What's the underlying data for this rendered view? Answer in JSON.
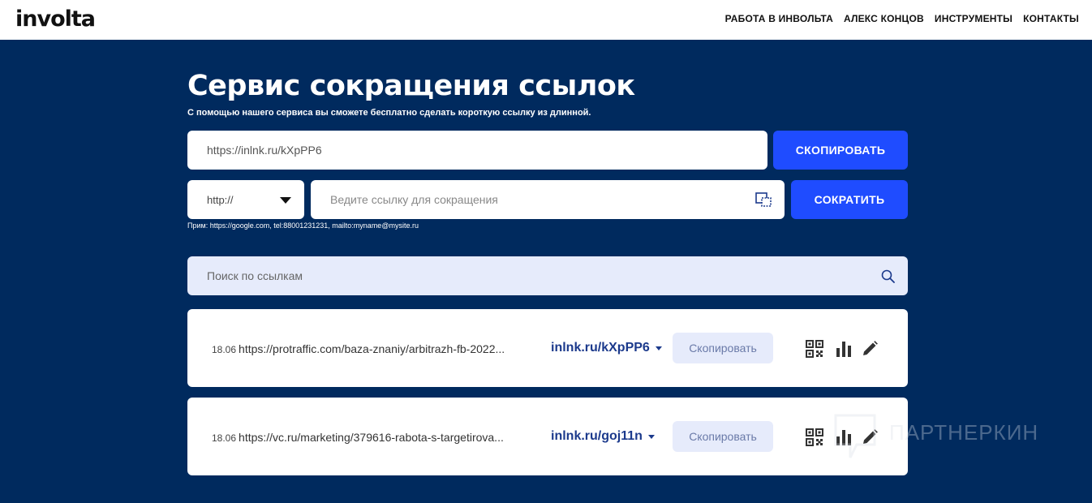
{
  "header": {
    "logo": "involta",
    "nav": [
      "РАБОТА В ИНВОЛЬТА",
      "АЛЕКС КОНЦОВ",
      "ИНСТРУМЕНТЫ",
      "КОНТАКТЫ"
    ]
  },
  "hero": {
    "title": "Сервис сокращения ссылок",
    "subtitle": "С помощью нашего сервиса вы сможете бесплатно сделать короткую ссылку из длинной."
  },
  "result": {
    "value": "https://inlnk.ru/kXpPP6",
    "copy_label": "СКОПИРОВАТЬ"
  },
  "shortener": {
    "protocol": "http://",
    "placeholder": "Ведите ссылку для сокращения",
    "submit_label": "СОКРАТИТЬ",
    "hint": "Прим: https://google.com, tel:88001231231, mailto:myname@mysite.ru"
  },
  "search": {
    "placeholder": "Поиск по ссылкам"
  },
  "links": [
    {
      "date": "18.06",
      "url": "https://protraffic.com/baza-znaniy/arbitrazh-fb-2022...",
      "short": "inlnk.ru/kXpPP6",
      "copy_label": "Скопировать"
    },
    {
      "date": "18.06",
      "url": "https://vc.ru/marketing/379616-rabota-s-targetirova...",
      "short": "inlnk.ru/goj11n",
      "copy_label": "Скопировать"
    }
  ],
  "watermark": "ПАРТНЕРКИН",
  "colors": {
    "background": "#002a5e",
    "accent": "#1f4cff",
    "light_field": "#e6ebfb",
    "short_link": "#1c3a8c"
  },
  "icons": {
    "protocol_toggle": "caret-down-icon",
    "paste": "paste-icon",
    "search": "search-icon",
    "link_actions": [
      "qr-code-icon",
      "bar-chart-icon",
      "pencil-icon"
    ]
  }
}
